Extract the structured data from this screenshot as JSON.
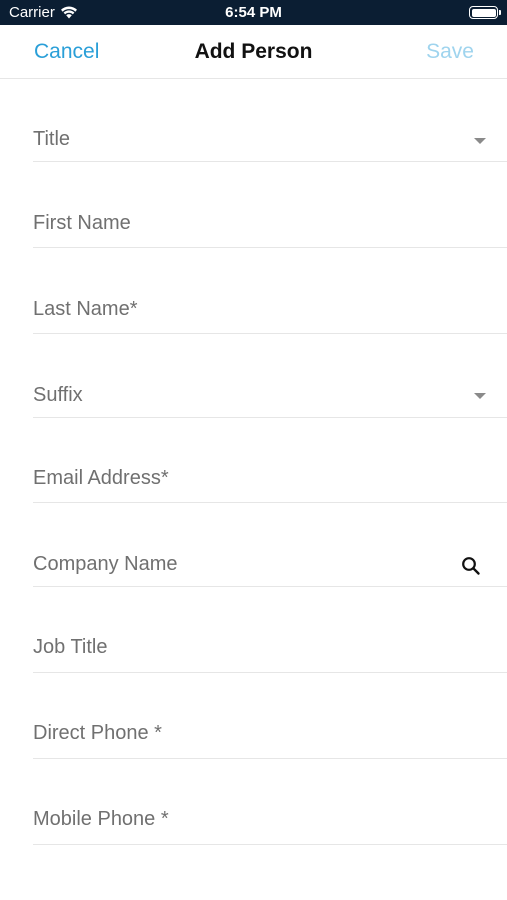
{
  "status_bar": {
    "carrier": "Carrier",
    "time": "6:54 PM"
  },
  "nav": {
    "cancel_label": "Cancel",
    "title": "Add Person",
    "save_label": "Save"
  },
  "colors": {
    "accent": "#2a9fd8",
    "accent_disabled": "#9fd4ee",
    "status_bar_bg": "#0b1e33",
    "placeholder_text": "#707070",
    "divider": "#e6e6e6"
  },
  "form": {
    "fields": [
      {
        "label": "Title",
        "type": "dropdown",
        "icon": "chevron-down-icon"
      },
      {
        "label": "First Name",
        "type": "text"
      },
      {
        "label": "Last Name*",
        "type": "text"
      },
      {
        "label": "Suffix",
        "type": "dropdown",
        "icon": "chevron-down-icon"
      },
      {
        "label": "Email Address*",
        "type": "text"
      },
      {
        "label": "Company Name",
        "type": "search",
        "icon": "search-icon"
      },
      {
        "label": "Job Title",
        "type": "text"
      },
      {
        "label": "Direct Phone *",
        "type": "text"
      },
      {
        "label": "Mobile Phone *",
        "type": "text"
      }
    ]
  }
}
